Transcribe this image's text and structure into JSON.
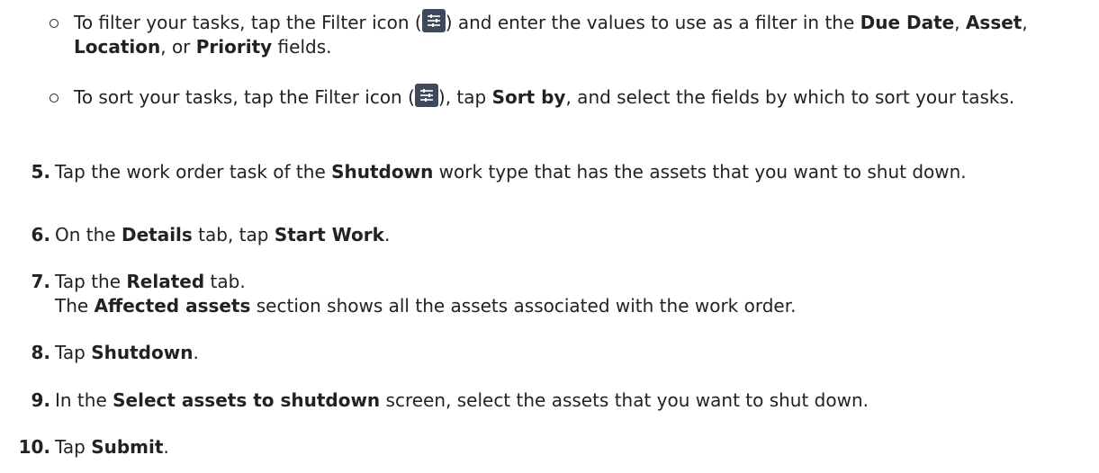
{
  "sub_bullets": [
    {
      "pre": "To filter your tasks, tap the Filter icon (",
      "icon": "filter-icon",
      "mid": ") and enter the values to use as a filter in the ",
      "b1": "Due Date",
      "s1": ", ",
      "b2": "Asset",
      "s2": ", ",
      "b3": "Location",
      "s3": ", or ",
      "b4": "Priority",
      "post": " fields."
    },
    {
      "pre": "To sort your tasks, tap the Filter icon (",
      "icon": "filter-icon",
      "mid": "), tap ",
      "b1": "Sort by",
      "post": ", and select the fields by which to sort your tasks."
    }
  ],
  "steps": [
    {
      "num": "5.",
      "pre": "Tap the work order task of the ",
      "b1": "Shutdown",
      "post": " work type that has the assets that you want to shut down."
    },
    {
      "num": "6.",
      "pre": "On the ",
      "b1": "Details",
      "mid": " tab, tap ",
      "b2": "Start Work",
      "post": "."
    },
    {
      "num": "7.",
      "pre": "Tap the ",
      "b1": "Related",
      "post": " tab.",
      "line2_pre": "The ",
      "line2_b": "Affected assets",
      "line2_post": " section shows all the assets associated with the work order."
    },
    {
      "num": "8.",
      "pre": "Tap ",
      "b1": "Shutdown",
      "post": "."
    },
    {
      "num": "9.",
      "pre": "In the ",
      "b1": "Select assets to shutdown",
      "post": " screen, select the assets that you want to shut down."
    },
    {
      "num": "10.",
      "pre": "Tap ",
      "b1": "Submit",
      "post": "."
    }
  ],
  "colors": {
    "text": "#222222",
    "icon_bg": "#3e4a5b",
    "icon_fg": "#ffffff"
  }
}
